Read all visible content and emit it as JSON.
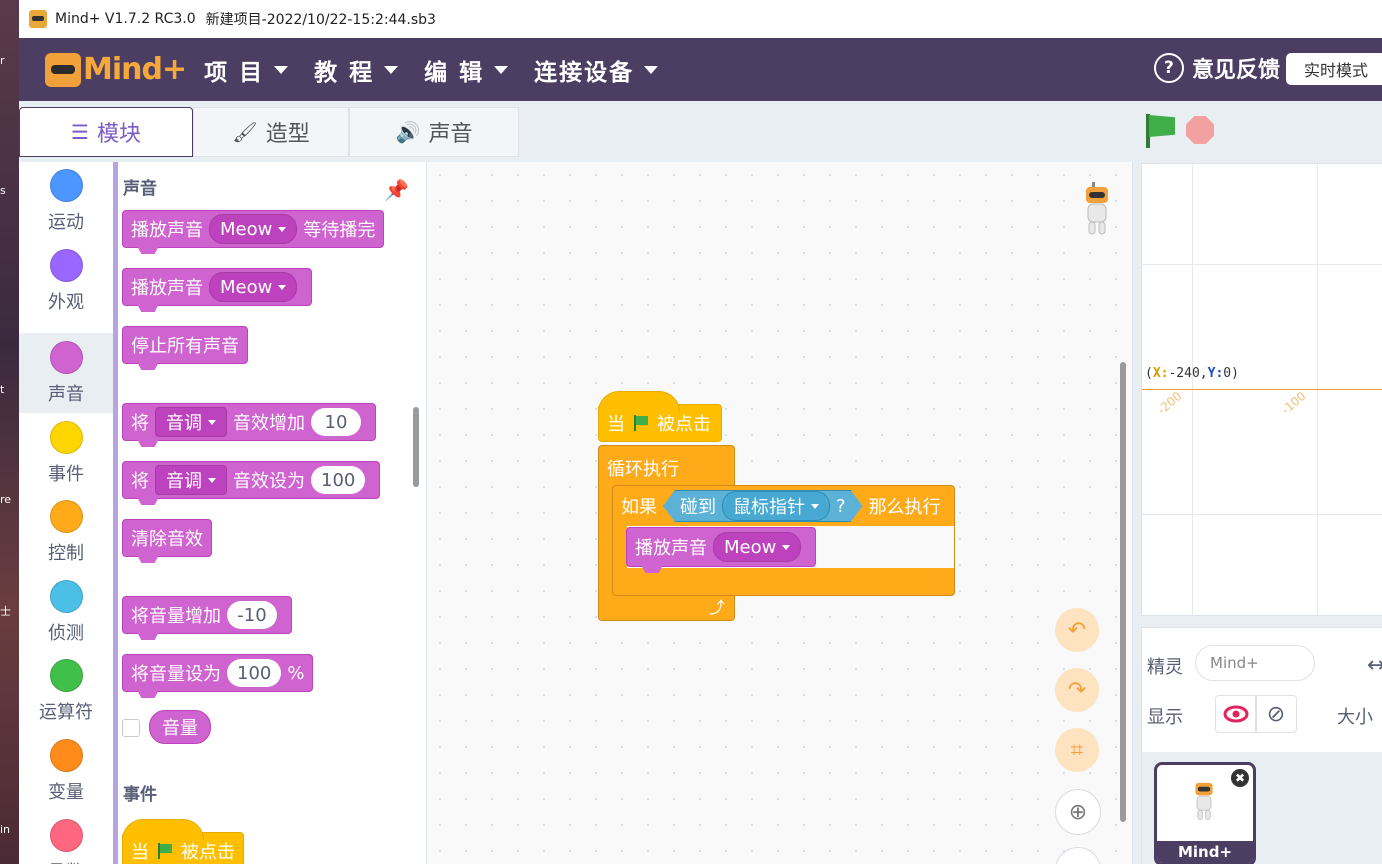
{
  "desktop": {
    "edge_labels": [
      "r",
      "s",
      "t",
      "re",
      "士",
      "in"
    ]
  },
  "titlebar": {
    "app": "Mind+ V1.7.2 RC3.0",
    "project": "新建项目-2022/10/22-15:2:44.sb3"
  },
  "menubar": {
    "logo": "Mind+",
    "menus": [
      "项 目",
      "教 程",
      "编 辑",
      "连接设备"
    ],
    "feedback": "意见反馈",
    "mode": "实时模式"
  },
  "tabs": {
    "blocks": "模块",
    "costumes": "造型",
    "sounds": "声音"
  },
  "categories": [
    {
      "label": "运动",
      "color": "#4c97ff"
    },
    {
      "label": "外观",
      "color": "#9966ff"
    },
    {
      "label": "声音",
      "color": "#cf63cf"
    },
    {
      "label": "事件",
      "color": "#ffd500"
    },
    {
      "label": "控制",
      "color": "#ffab19"
    },
    {
      "label": "侦测",
      "color": "#4cbfe6"
    },
    {
      "label": "运算符",
      "color": "#40bf4a"
    },
    {
      "label": "变量",
      "color": "#ff8c1a"
    },
    {
      "label": "函数",
      "color": "#ff6680"
    }
  ],
  "palette": {
    "sound_title": "声音",
    "play_until_done": {
      "pre": "播放声音",
      "drop": "Meow",
      "post": "等待播完"
    },
    "start_sound": {
      "pre": "播放声音",
      "drop": "Meow"
    },
    "stop_all": "停止所有声音",
    "change_effect": {
      "pre": "将",
      "drop": "音调",
      "mid": "音效增加",
      "val": "10"
    },
    "set_effect": {
      "pre": "将",
      "drop": "音调",
      "mid": "音效设为",
      "val": "100"
    },
    "clear_effects": "清除音效",
    "change_volume": {
      "pre": "将音量增加",
      "val": "-10"
    },
    "set_volume": {
      "pre": "将音量设为",
      "val": "100",
      "unit": "%"
    },
    "volume_reporter": "音量",
    "events_title": "事件",
    "when_flag": {
      "pre": "当",
      "post": "被点击"
    }
  },
  "script": {
    "hat": {
      "pre": "当",
      "post": "被点击"
    },
    "forever": "循环执行",
    "if": {
      "pre": "如果",
      "sensing": "碰到",
      "drop": "鼠标指针",
      "q": "?",
      "post": "那么执行"
    },
    "play": {
      "pre": "播放声音",
      "drop": "Meow"
    },
    "loop_arrow": "⤴"
  },
  "canvas_controls": {
    "undo": "↶",
    "redo": "↷",
    "crop": "⌗",
    "zoom_in": "⊕"
  },
  "stage": {
    "coord_prefix": "(",
    "x_label": "X:",
    "x_val": "-240",
    "sep": ",",
    "y_label": "Y:",
    "y_val": "0",
    "coord_suffix": ")",
    "ticks": [
      "-200",
      "-100"
    ]
  },
  "sprite_info": {
    "sprite_label": "精灵",
    "sprite_name": "Mind+",
    "show_label": "显示",
    "size_label": "大小"
  },
  "sprite_list": {
    "name": "Mind+",
    "close": "✖"
  }
}
